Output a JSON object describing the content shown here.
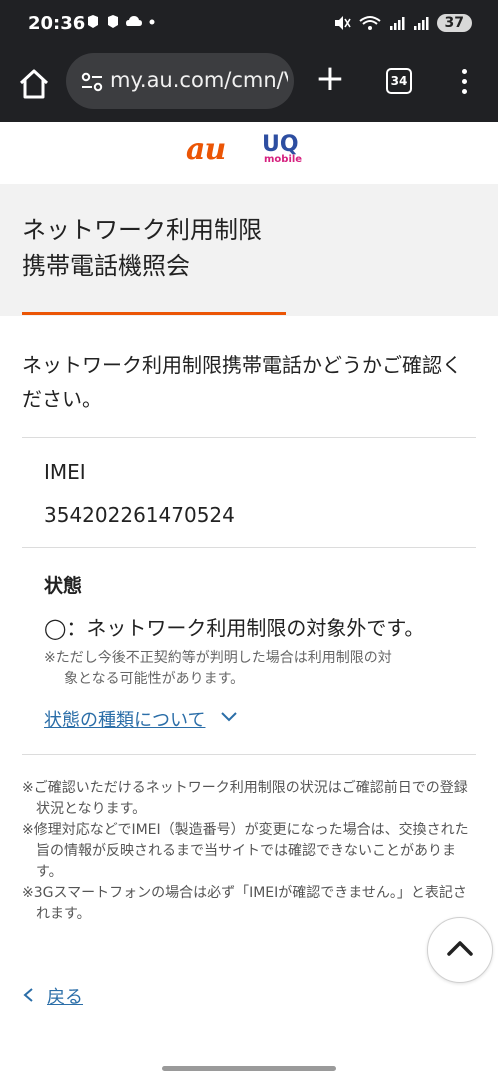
{
  "status_bar": {
    "time": "20:36",
    "notif_icons": [
      "app-icon",
      "app-icon",
      "cloud-icon",
      "dot"
    ],
    "battery": "37"
  },
  "browser": {
    "url": "my.au.com/cmn/V",
    "tab_count": "34"
  },
  "brand": {
    "au": "au",
    "uq": "UQ",
    "uq_sub": "mobile",
    "au_color": "#eb5505",
    "uq_color": "#2d4ea1",
    "mobile_color": "#d6217f"
  },
  "page": {
    "title_line1": "ネットワーク利用制限",
    "title_line2": "携帯電話機照会",
    "intro": "ネットワーク利用制限携帯電話かどうかご確認ください。"
  },
  "imei": {
    "label": "IMEI",
    "value": "354202261470524"
  },
  "status": {
    "heading": "状態",
    "text": "◯：ネットワーク利用制限の対象外です。",
    "note_line1": "※ただし今後不正契約等が判明した場合は利用制限の対",
    "note_line2": "象となる可能性があります。",
    "types_link": "状態の種類について"
  },
  "notes": [
    "※ご確認いただけるネットワーク利用制限の状況はご確認前日での登録状況となります。",
    "※修理対応などでIMEI（製造番号）が変更になった場合は、交換された旨の情報が反映されるまで当サイトでは確認できないことがあります。",
    "※3Gスマートフォンの場合は必ず「IMEIが確認できません。」と表記されます。"
  ],
  "back": {
    "label": "戻る"
  },
  "colors": {
    "accent_orange": "#eb5505",
    "link_blue": "#2b6ea8",
    "title_band_bg": "#f2f2f2",
    "chrome_bg": "#202124"
  }
}
